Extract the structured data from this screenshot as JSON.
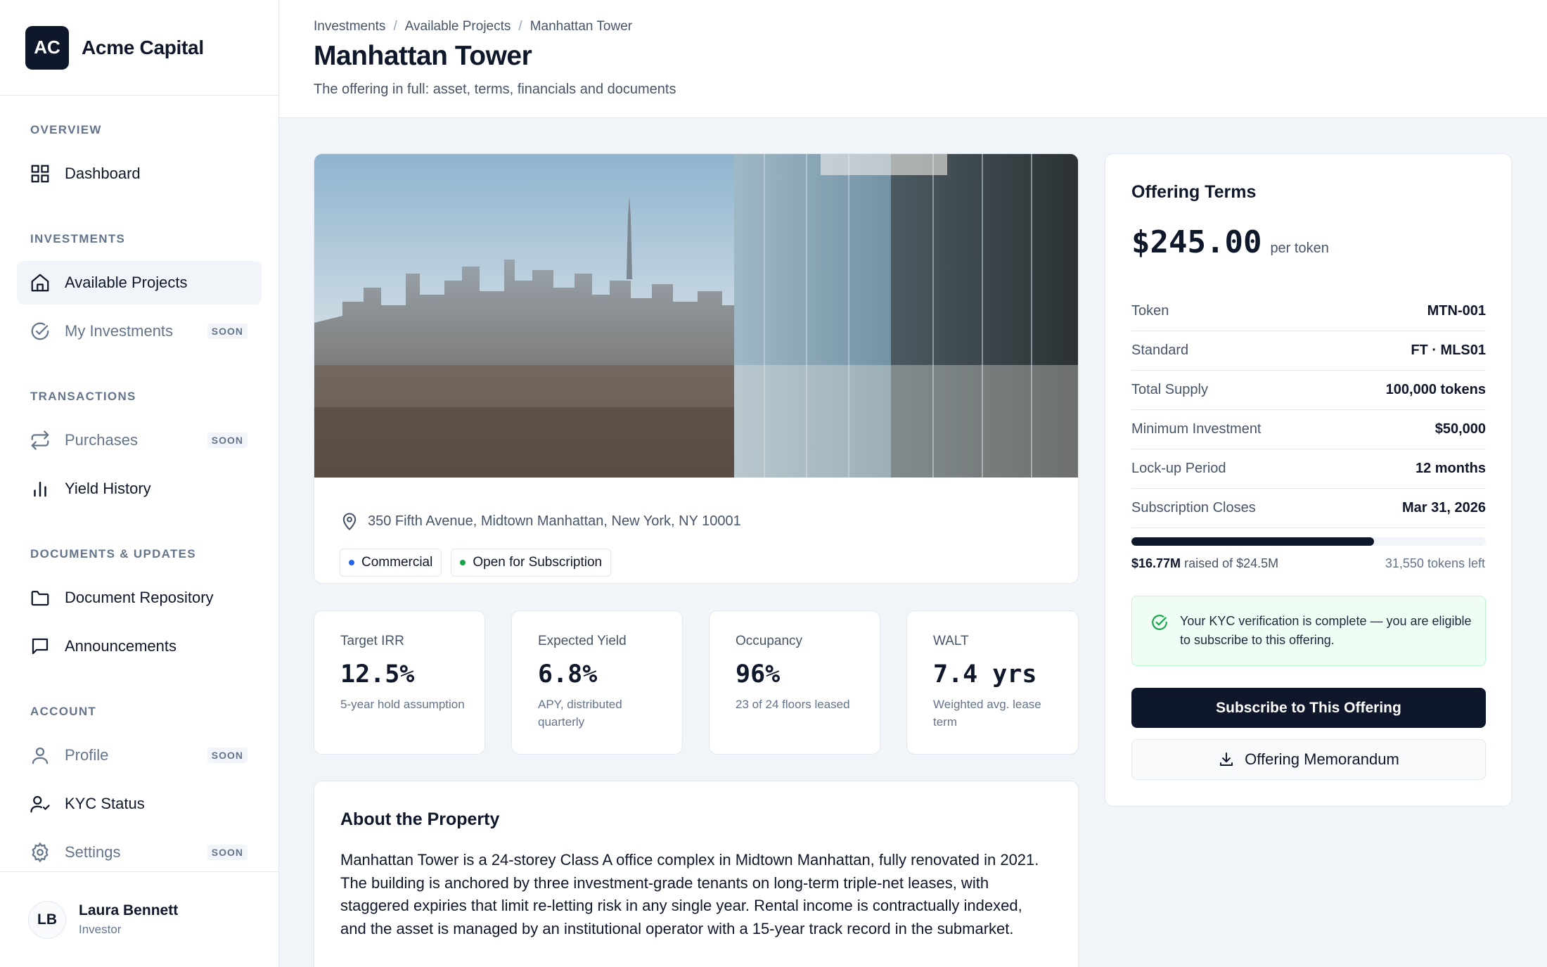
{
  "app": {
    "logo": "AC",
    "name": "Acme Capital"
  },
  "sidebar": {
    "sections": [
      {
        "title": "OVERVIEW"
      },
      {
        "title": "INVESTMENTS"
      },
      {
        "title": "TRANSACTIONS"
      },
      {
        "title": "DOCUMENTS & UPDATES"
      },
      {
        "title": "ACCOUNT"
      }
    ],
    "items": [
      {
        "label": "Dashboard",
        "icon": "grid-icon"
      },
      {
        "label": "Available Projects",
        "icon": "home-icon",
        "active": true
      },
      {
        "label": "My Investments",
        "icon": "check-circle-icon",
        "badge": "SOON"
      },
      {
        "label": "Purchases",
        "icon": "repeat-icon",
        "badge": "SOON"
      },
      {
        "label": "Yield History",
        "icon": "bar-chart-icon"
      },
      {
        "label": "Document Repository",
        "icon": "folder-icon"
      },
      {
        "label": "Announcements",
        "icon": "message-icon"
      },
      {
        "label": "Profile",
        "icon": "user-icon",
        "badge": "SOON"
      },
      {
        "label": "KYC Status",
        "icon": "user-check-icon"
      },
      {
        "label": "Settings",
        "icon": "gear-icon",
        "badge": "SOON"
      }
    ],
    "user": {
      "initials": "LB",
      "name": "Laura Bennett",
      "role": "Investor"
    }
  },
  "header": {
    "breadcrumbs": [
      "Investments",
      "Available Projects",
      "Manhattan Tower"
    ],
    "title": "Manhattan Tower",
    "subtitle": "The offering in full: asset, terms, financials and documents"
  },
  "property": {
    "address": "350 Fifth Avenue, Midtown Manhattan, New York, NY 10001",
    "tags": [
      {
        "label": "Commercial",
        "color": "#2563eb"
      },
      {
        "label": "Open for Subscription",
        "color": "#16a34a"
      }
    ]
  },
  "metrics": [
    {
      "label": "Target IRR",
      "value": "12.5%",
      "note": "5-year hold assumption"
    },
    {
      "label": "Expected Yield",
      "value": "6.8%",
      "note": "APY, distributed quarterly"
    },
    {
      "label": "Occupancy",
      "value": "96%",
      "note": "23 of 24 floors leased"
    },
    {
      "label": "WALT",
      "value": "7.4 yrs",
      "note": "Weighted avg. lease term"
    }
  ],
  "about": {
    "title": "About the Property",
    "text": "Manhattan Tower is a 24-storey Class A office complex in Midtown Manhattan, fully renovated in 2021. The building is anchored by three investment-grade tenants on long-term triple-net leases, with staggered expiries that limit re-letting risk in any single year. Rental income is contractually indexed, and the asset is managed by an institutional operator with a 15-year track record in the submarket."
  },
  "terms": {
    "title": "Offering Terms",
    "price": "$245.00",
    "price_unit": "per token",
    "rows": [
      {
        "label": "Token",
        "value": "MTN-001"
      },
      {
        "label": "Standard",
        "value": "FT · MLS01"
      },
      {
        "label": "Total Supply",
        "value": "100,000 tokens"
      },
      {
        "label": "Minimum Investment",
        "value": "$50,000"
      },
      {
        "label": "Lock-up Period",
        "value": "12 months"
      },
      {
        "label": "Subscription Closes",
        "value": "Mar 31, 2026"
      }
    ],
    "raised_amount": "$16.77M",
    "raised_suffix": "raised of $24.5M",
    "progress_fraction": 0.684,
    "tokens_left": "31,550 tokens left",
    "kyc_message": "Your KYC verification is complete — you are eligible to subscribe to this offering.",
    "subscribe_label": "Subscribe to This Offering",
    "memorandum_label": "Offering Memorandum"
  },
  "colors": {
    "primary": "#0f172a",
    "success": "#16a34a",
    "accent": "#2563eb"
  }
}
